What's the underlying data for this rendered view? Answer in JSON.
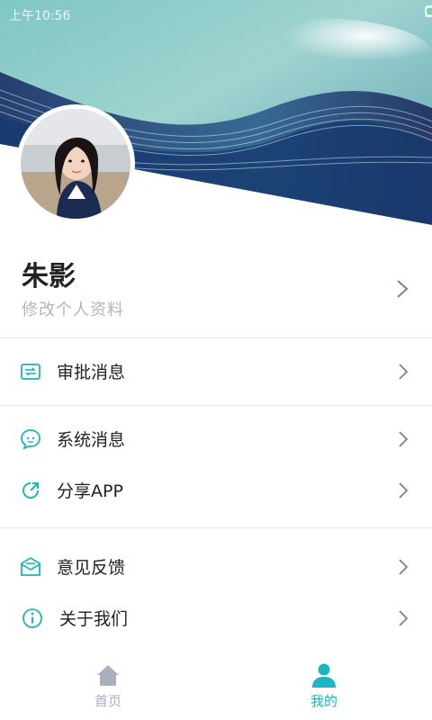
{
  "status_bar": {
    "time": "上午10:56"
  },
  "profile": {
    "name": "朱影",
    "edit_label": "修改个人资料"
  },
  "menu": {
    "approval": "审批消息",
    "system": "系统消息",
    "share": "分享APP",
    "feedback": "意见反馈",
    "about": "关于我们"
  },
  "tabbar": {
    "tabs": [
      {
        "label": "首页",
        "active": false
      },
      {
        "label": "我的",
        "active": true
      }
    ]
  },
  "colors": {
    "accent": "#1db5be",
    "inactive": "#a8b0bd",
    "text": "#222222",
    "banner_dark": "#1c2a5c"
  }
}
